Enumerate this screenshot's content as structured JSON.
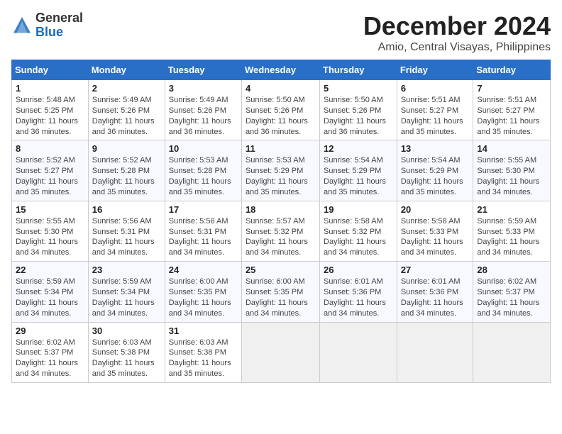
{
  "logo": {
    "general": "General",
    "blue": "Blue"
  },
  "title": {
    "month": "December 2024",
    "location": "Amio, Central Visayas, Philippines"
  },
  "weekdays": [
    "Sunday",
    "Monday",
    "Tuesday",
    "Wednesday",
    "Thursday",
    "Friday",
    "Saturday"
  ],
  "weeks": [
    [
      {
        "day": "1",
        "info": "Sunrise: 5:48 AM\nSunset: 5:25 PM\nDaylight: 11 hours\nand 36 minutes."
      },
      {
        "day": "2",
        "info": "Sunrise: 5:49 AM\nSunset: 5:26 PM\nDaylight: 11 hours\nand 36 minutes."
      },
      {
        "day": "3",
        "info": "Sunrise: 5:49 AM\nSunset: 5:26 PM\nDaylight: 11 hours\nand 36 minutes."
      },
      {
        "day": "4",
        "info": "Sunrise: 5:50 AM\nSunset: 5:26 PM\nDaylight: 11 hours\nand 36 minutes."
      },
      {
        "day": "5",
        "info": "Sunrise: 5:50 AM\nSunset: 5:26 PM\nDaylight: 11 hours\nand 36 minutes."
      },
      {
        "day": "6",
        "info": "Sunrise: 5:51 AM\nSunset: 5:27 PM\nDaylight: 11 hours\nand 35 minutes."
      },
      {
        "day": "7",
        "info": "Sunrise: 5:51 AM\nSunset: 5:27 PM\nDaylight: 11 hours\nand 35 minutes."
      }
    ],
    [
      {
        "day": "8",
        "info": "Sunrise: 5:52 AM\nSunset: 5:27 PM\nDaylight: 11 hours\nand 35 minutes."
      },
      {
        "day": "9",
        "info": "Sunrise: 5:52 AM\nSunset: 5:28 PM\nDaylight: 11 hours\nand 35 minutes."
      },
      {
        "day": "10",
        "info": "Sunrise: 5:53 AM\nSunset: 5:28 PM\nDaylight: 11 hours\nand 35 minutes."
      },
      {
        "day": "11",
        "info": "Sunrise: 5:53 AM\nSunset: 5:29 PM\nDaylight: 11 hours\nand 35 minutes."
      },
      {
        "day": "12",
        "info": "Sunrise: 5:54 AM\nSunset: 5:29 PM\nDaylight: 11 hours\nand 35 minutes."
      },
      {
        "day": "13",
        "info": "Sunrise: 5:54 AM\nSunset: 5:29 PM\nDaylight: 11 hours\nand 35 minutes."
      },
      {
        "day": "14",
        "info": "Sunrise: 5:55 AM\nSunset: 5:30 PM\nDaylight: 11 hours\nand 34 minutes."
      }
    ],
    [
      {
        "day": "15",
        "info": "Sunrise: 5:55 AM\nSunset: 5:30 PM\nDaylight: 11 hours\nand 34 minutes."
      },
      {
        "day": "16",
        "info": "Sunrise: 5:56 AM\nSunset: 5:31 PM\nDaylight: 11 hours\nand 34 minutes."
      },
      {
        "day": "17",
        "info": "Sunrise: 5:56 AM\nSunset: 5:31 PM\nDaylight: 11 hours\nand 34 minutes."
      },
      {
        "day": "18",
        "info": "Sunrise: 5:57 AM\nSunset: 5:32 PM\nDaylight: 11 hours\nand 34 minutes."
      },
      {
        "day": "19",
        "info": "Sunrise: 5:58 AM\nSunset: 5:32 PM\nDaylight: 11 hours\nand 34 minutes."
      },
      {
        "day": "20",
        "info": "Sunrise: 5:58 AM\nSunset: 5:33 PM\nDaylight: 11 hours\nand 34 minutes."
      },
      {
        "day": "21",
        "info": "Sunrise: 5:59 AM\nSunset: 5:33 PM\nDaylight: 11 hours\nand 34 minutes."
      }
    ],
    [
      {
        "day": "22",
        "info": "Sunrise: 5:59 AM\nSunset: 5:34 PM\nDaylight: 11 hours\nand 34 minutes."
      },
      {
        "day": "23",
        "info": "Sunrise: 5:59 AM\nSunset: 5:34 PM\nDaylight: 11 hours\nand 34 minutes."
      },
      {
        "day": "24",
        "info": "Sunrise: 6:00 AM\nSunset: 5:35 PM\nDaylight: 11 hours\nand 34 minutes."
      },
      {
        "day": "25",
        "info": "Sunrise: 6:00 AM\nSunset: 5:35 PM\nDaylight: 11 hours\nand 34 minutes."
      },
      {
        "day": "26",
        "info": "Sunrise: 6:01 AM\nSunset: 5:36 PM\nDaylight: 11 hours\nand 34 minutes."
      },
      {
        "day": "27",
        "info": "Sunrise: 6:01 AM\nSunset: 5:36 PM\nDaylight: 11 hours\nand 34 minutes."
      },
      {
        "day": "28",
        "info": "Sunrise: 6:02 AM\nSunset: 5:37 PM\nDaylight: 11 hours\nand 34 minutes."
      }
    ],
    [
      {
        "day": "29",
        "info": "Sunrise: 6:02 AM\nSunset: 5:37 PM\nDaylight: 11 hours\nand 34 minutes."
      },
      {
        "day": "30",
        "info": "Sunrise: 6:03 AM\nSunset: 5:38 PM\nDaylight: 11 hours\nand 35 minutes."
      },
      {
        "day": "31",
        "info": "Sunrise: 6:03 AM\nSunset: 5:38 PM\nDaylight: 11 hours\nand 35 minutes."
      },
      {
        "day": "",
        "info": ""
      },
      {
        "day": "",
        "info": ""
      },
      {
        "day": "",
        "info": ""
      },
      {
        "day": "",
        "info": ""
      }
    ]
  ]
}
